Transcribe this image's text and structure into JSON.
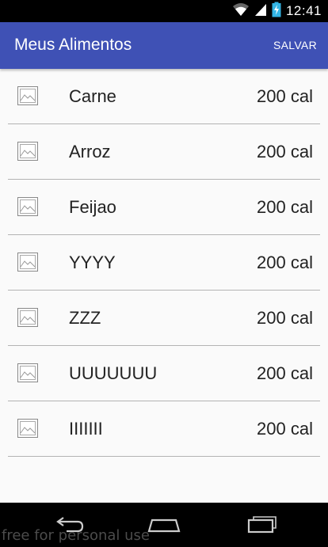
{
  "status_bar": {
    "time": "12:41",
    "icons": [
      "wifi-icon",
      "cell-signal-icon",
      "battery-charging-icon"
    ]
  },
  "app_bar": {
    "title": "Meus Alimentos",
    "action_label": "SALVAR"
  },
  "items": [
    {
      "name": "Carne",
      "calories": "200 cal",
      "icon": "image-placeholder-icon"
    },
    {
      "name": "Arroz",
      "calories": "200 cal",
      "icon": "image-placeholder-icon"
    },
    {
      "name": "Feijao",
      "calories": "200 cal",
      "icon": "image-placeholder-icon"
    },
    {
      "name": "YYYY",
      "calories": "200 cal",
      "icon": "image-placeholder-icon"
    },
    {
      "name": "ZZZ",
      "calories": "200 cal",
      "icon": "image-placeholder-icon"
    },
    {
      "name": "UUUUUUU",
      "calories": "200 cal",
      "icon": "image-placeholder-icon"
    },
    {
      "name": "IIIIIII",
      "calories": "200 cal",
      "icon": "image-placeholder-icon"
    }
  ],
  "nav_bar": {
    "buttons": [
      "back-icon",
      "home-icon",
      "recents-icon"
    ]
  },
  "watermark": "free for personal use",
  "colors": {
    "app_bar": "#3f51b5",
    "status_bar": "#000000",
    "background": "#fafafa",
    "divider": "#b3b3b3"
  }
}
